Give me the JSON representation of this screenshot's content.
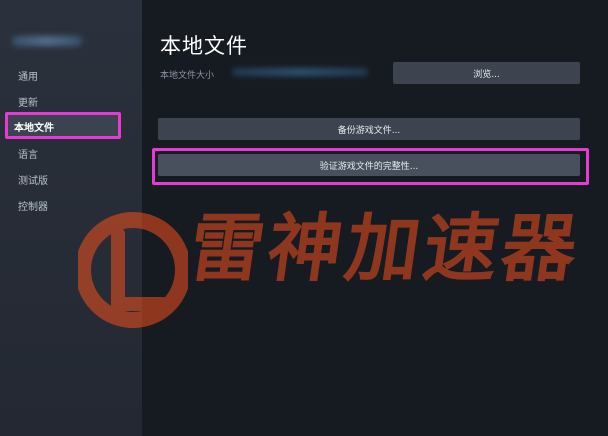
{
  "sidebar": {
    "items": [
      {
        "label": "通用"
      },
      {
        "label": "更新"
      },
      {
        "label": "本地文件"
      },
      {
        "label": "语言"
      },
      {
        "label": "测试版"
      },
      {
        "label": "控制器"
      }
    ],
    "active_index": 2
  },
  "main": {
    "title": "本地文件",
    "size_label": "本地文件大小",
    "browse_label": "浏览...",
    "backup_label": "备份游戏文件...",
    "verify_label": "验证游戏文件的完整性..."
  },
  "watermark": {
    "text": "雷神加速器"
  },
  "colors": {
    "highlight": "#e63ad4",
    "watermark": "#f2501d"
  }
}
